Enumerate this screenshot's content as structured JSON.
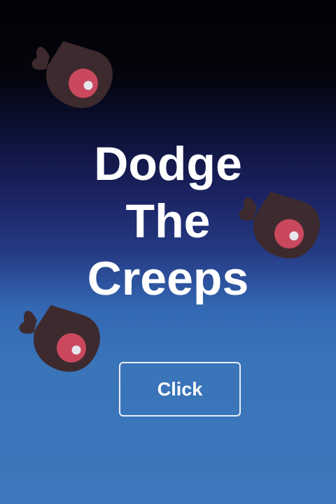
{
  "title": {
    "line1": "Dodge",
    "line2": "The",
    "line3": "Creeps"
  },
  "start_button": {
    "label": "Click"
  },
  "colors": {
    "background_top": "#020205",
    "background_bottom": "#3c78bb",
    "creep_body": "#3d2a2e",
    "creep_eye": "#c9485d",
    "creep_pupil": "#e6e6ec",
    "text": "#ffffff"
  },
  "sprites": {
    "enemies": [
      "creep-icon",
      "creep-icon",
      "creep-icon"
    ]
  }
}
